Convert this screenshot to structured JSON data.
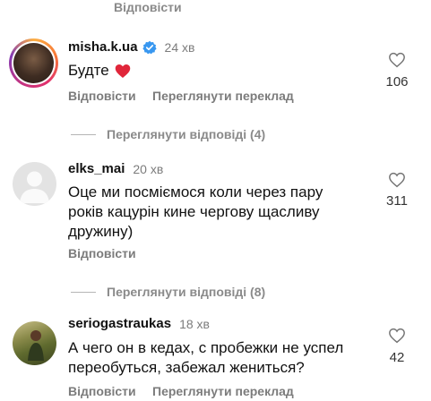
{
  "top_reply": "Відповісти",
  "comments": [
    {
      "username": "misha.k.ua",
      "time": "24 хв",
      "text": "Будте",
      "reply": "Відповісти",
      "translate": "Переглянути переклад",
      "likes": "106"
    },
    {
      "username": "elks_mai",
      "time": "20 хв",
      "text_lines": [
        "Оце ми посміємося коли через пару",
        "років кацурін кине чергову щасливу",
        "дружину)"
      ],
      "reply": "Відповісти",
      "likes": "311"
    },
    {
      "username": "seriogastraukas",
      "time": "18 хв",
      "text_lines": [
        "А чего он в кедах, с пробежки не успел",
        "переобуться, забежал жениться?"
      ],
      "reply": "Відповісти",
      "translate": "Переглянути переклад",
      "likes": "42"
    }
  ],
  "view_replies": [
    "Переглянути відповіді (4)",
    "Переглянути відповіді (8)"
  ],
  "colors": {
    "heart_emoji": "#e0263a",
    "verified": "#3897f0"
  }
}
